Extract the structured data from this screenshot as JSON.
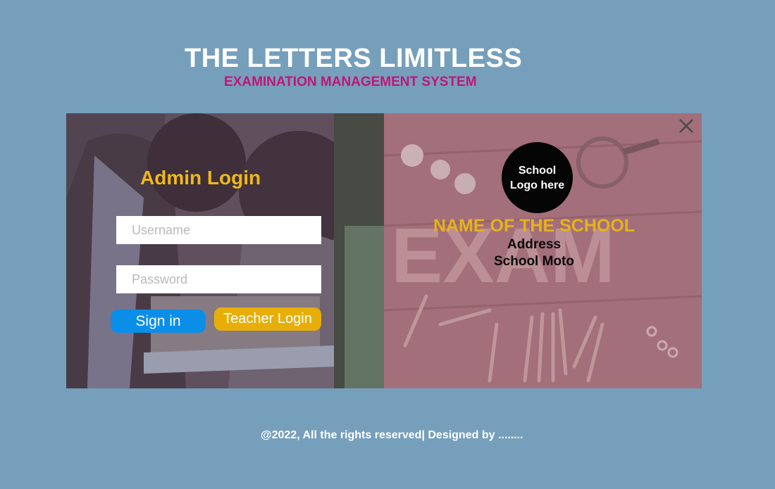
{
  "header": {
    "title": "THE LETTERS LIMITLESS",
    "subtitle": "EXAMINATION MANAGEMENT SYSTEM"
  },
  "login": {
    "heading": "Admin Login",
    "username_placeholder": "Username",
    "username_value": "",
    "password_placeholder": "Password",
    "password_value": "",
    "signin_label": "Sign in",
    "teacher_label": "Teacher Login"
  },
  "school": {
    "logo_text": "School Logo here",
    "name": "NAME OF THE SCHOOL",
    "address": "Address",
    "moto": "School Moto"
  },
  "footer": {
    "text": "@2022, All the rights reserved| Designed by ........"
  },
  "icons": {
    "close": "close-icon"
  },
  "colors": {
    "background": "#769fbb",
    "subtitle": "#c0157a",
    "heading": "#f0b81a",
    "signin": "#0b8ee8",
    "teacher": "#e8ae08",
    "school_name": "#e6b21b"
  }
}
